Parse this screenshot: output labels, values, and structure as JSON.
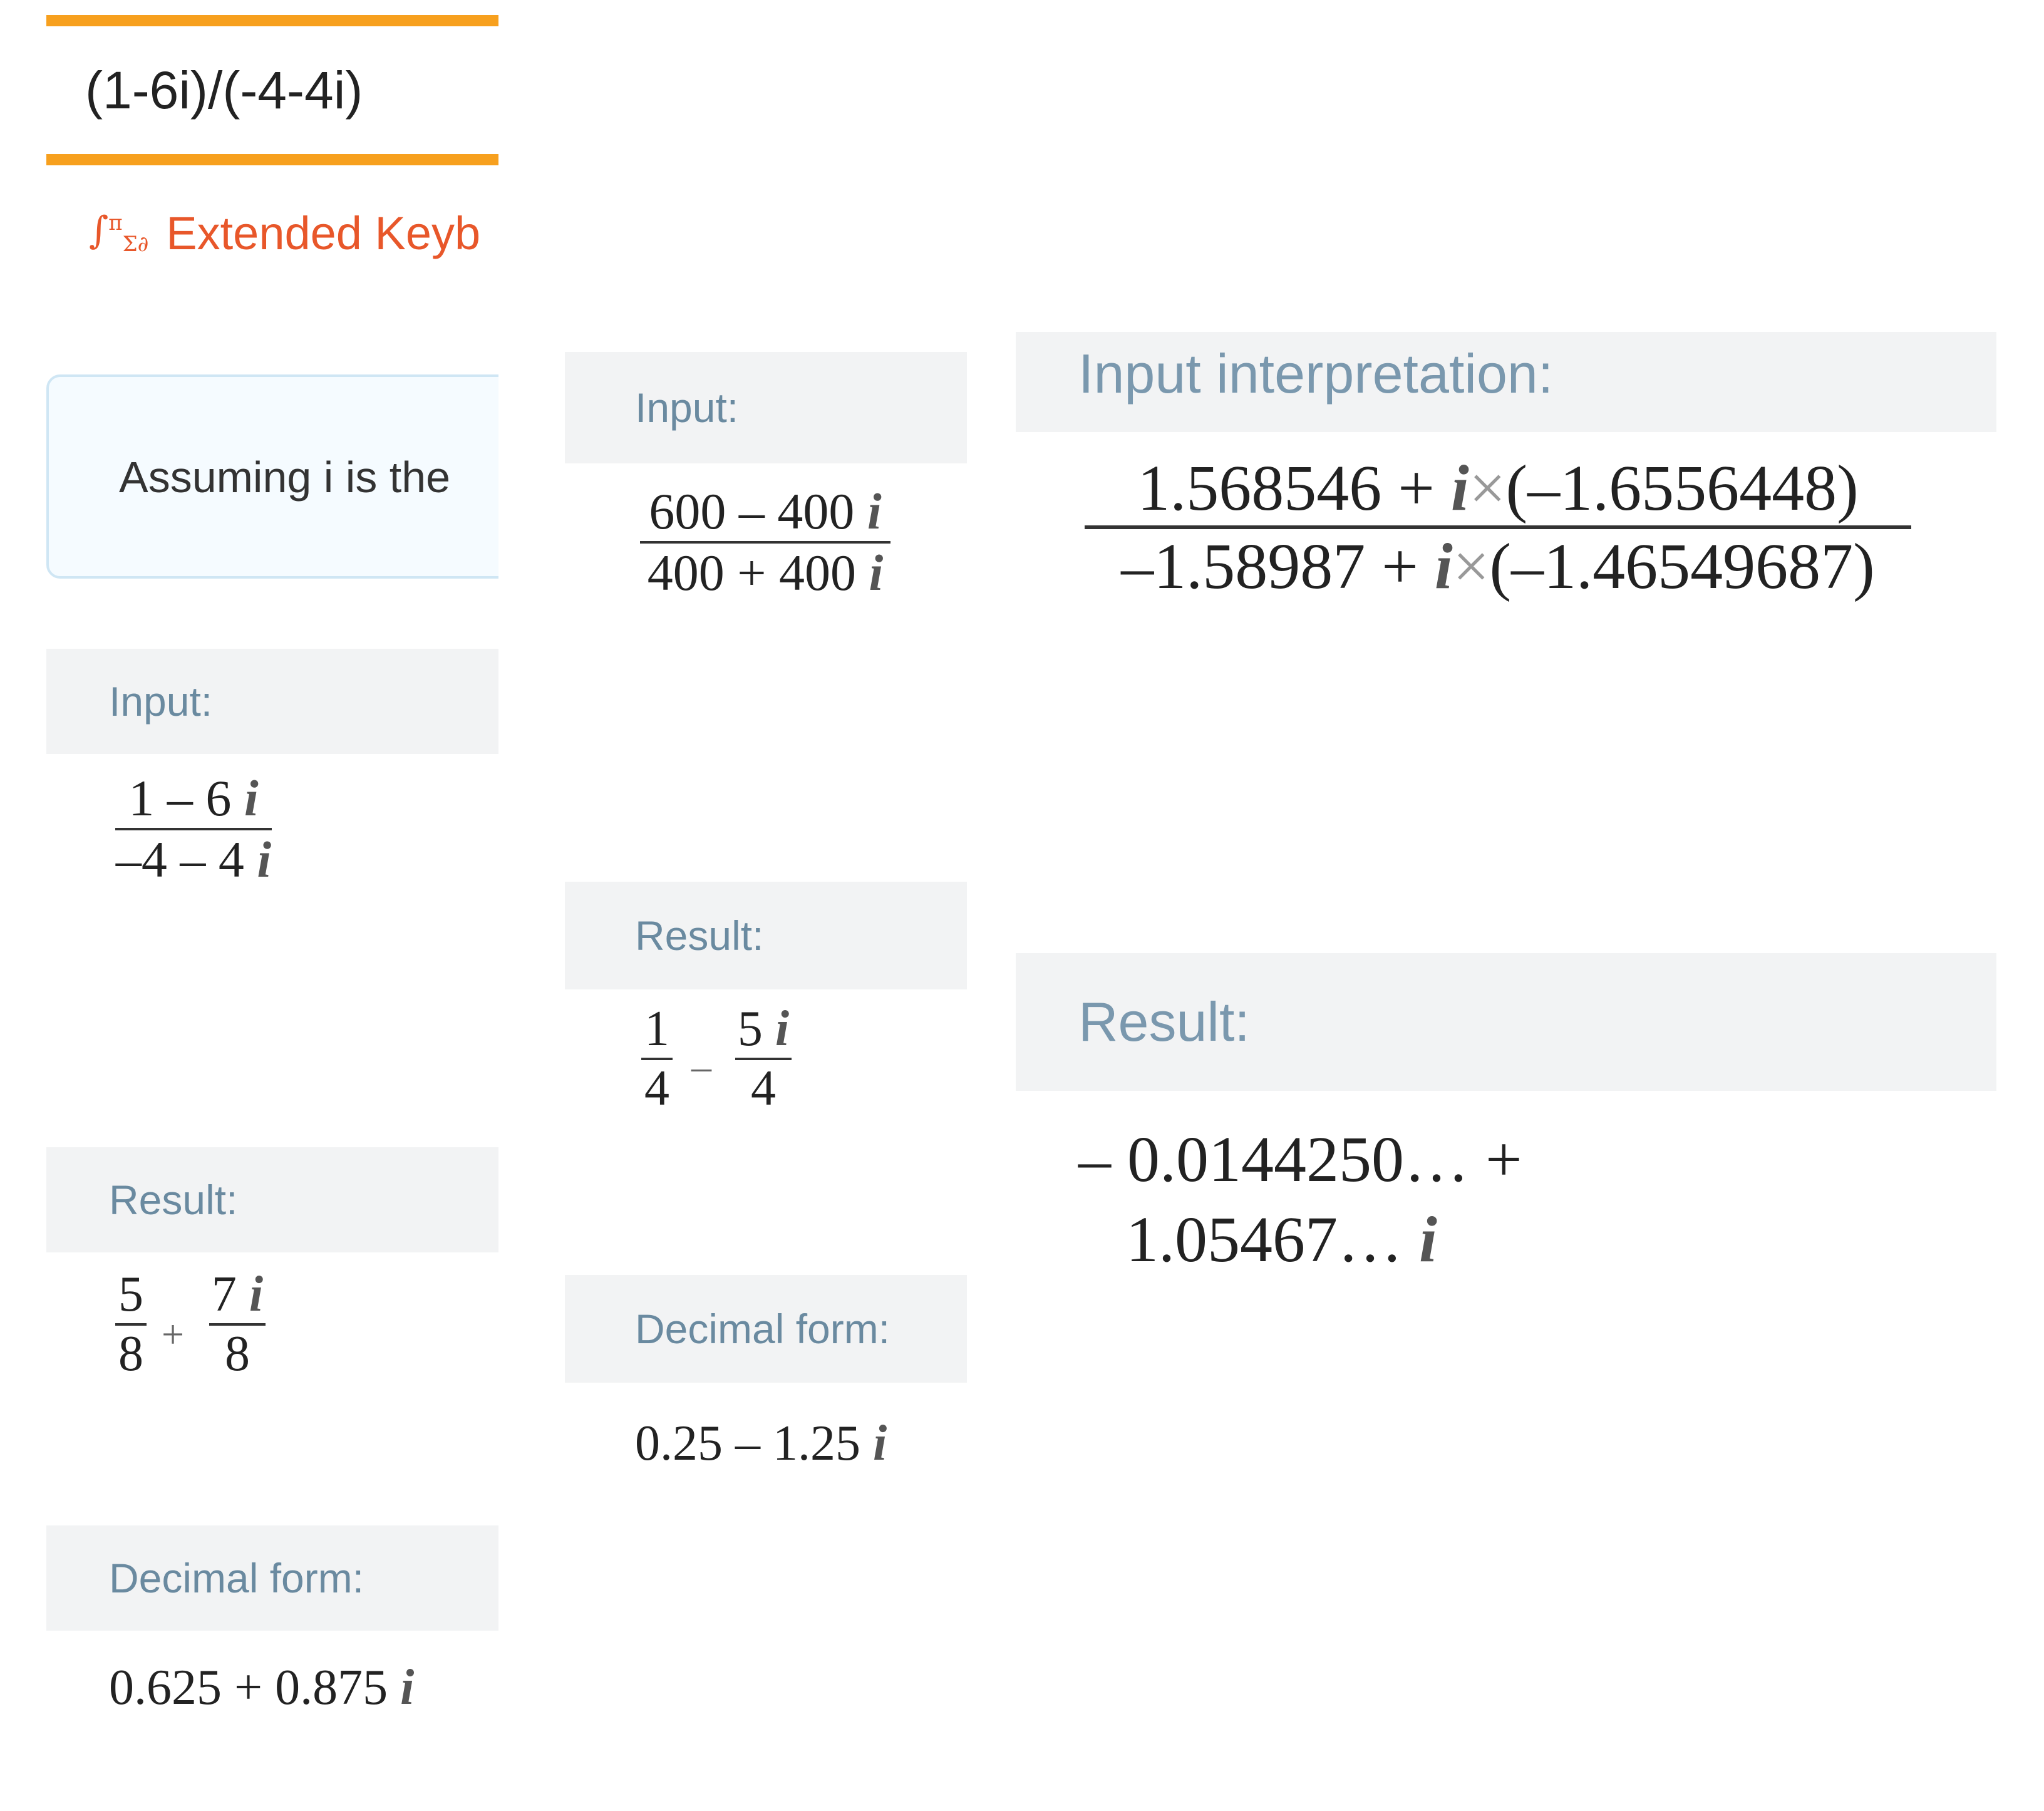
{
  "left": {
    "query": "(1-6i)/(-4-4i)",
    "extended_keyboard_icon": "integral-pi-sigma-keyboard-icon",
    "extended_keyboard_label": "Extended Keyb",
    "assumption_text": "Assuming i is the",
    "input_header": "Input:",
    "input_num_a": "1 – 6",
    "input_num_i": "i",
    "input_den_a": "–4 – 4",
    "input_den_i": "i",
    "result_header": "Result:",
    "result_f1_num": "5",
    "result_f1_den": "8",
    "result_op": "+",
    "result_f2_num_a": "7",
    "result_f2_num_i": "i",
    "result_f2_den": "8",
    "decimal_header": "Decimal form:",
    "decimal_a": "0.625 + 0.875",
    "decimal_i": "i"
  },
  "middle": {
    "input_header": "Input:",
    "input_num_a": "600 – 400",
    "input_num_i": "i",
    "input_den_a": "400 + 400",
    "input_den_i": "i",
    "result_header": "Result:",
    "result_f1_num": "1",
    "result_f1_den": "4",
    "result_op": "–",
    "result_f2_num_a": "5",
    "result_f2_num_i": "i",
    "result_f2_den": "4",
    "decimal_header": "Decimal form:",
    "decimal_a": "0.25 – 1.25",
    "decimal_i": "i"
  },
  "right": {
    "interp_header": "Input interpretation:",
    "num_a": "1.568546 + ",
    "num_i": "i",
    "num_x": "×",
    "num_b": "(–1.6556448)",
    "den_a": "–1.58987 + ",
    "den_i": "i",
    "den_x": "×",
    "den_b": "(–1.46549687)",
    "result_header": "Result:",
    "result_line1": "– 0.0144250… +",
    "result_line2_a": "1.05467… ",
    "result_line2_i": "i"
  },
  "colors": {
    "accent_orange": "#f7a01e",
    "link_orange": "#e8572a",
    "pod_header_bg": "#f2f3f4",
    "pod_header_text": "#6a8aa0"
  }
}
